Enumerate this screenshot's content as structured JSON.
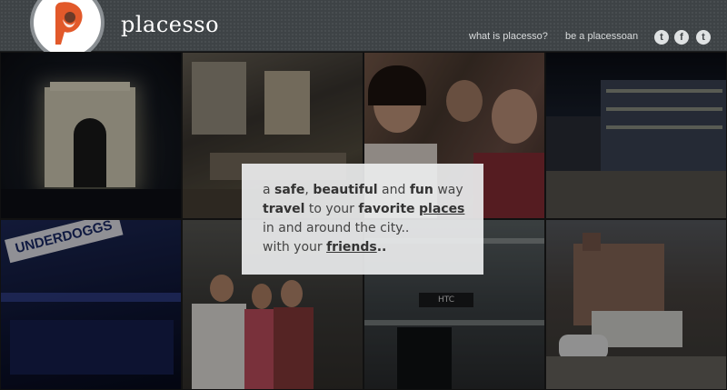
{
  "brand": {
    "name": "placesso",
    "logo_letter": "P"
  },
  "nav": {
    "what": "what is placesso?",
    "be": "be a placessoan"
  },
  "social": {
    "tumblr": "t",
    "facebook": "f",
    "twitter": "t"
  },
  "hero": {
    "l1_a": "a ",
    "l1_safe": "safe",
    "l1_b": ", ",
    "l1_beautiful": "beautiful",
    "l1_c": " and ",
    "l1_fun": "fun",
    "l1_d": " way",
    "l2_travel": "travel",
    "l2_a": " to your ",
    "l2_favorite": "favorite",
    "l2_b": " ",
    "l2_places": "places",
    "l3": "in and around the city..",
    "l4_a": "with your ",
    "l4_friends": "friends",
    "l4_b": ".."
  },
  "tiles": {
    "underdoggs": "UNDERDOGGS",
    "htc": "HTC"
  },
  "colors": {
    "header": "#3e4346",
    "logo_accent": "#e2592a",
    "card": "#ecedee"
  }
}
